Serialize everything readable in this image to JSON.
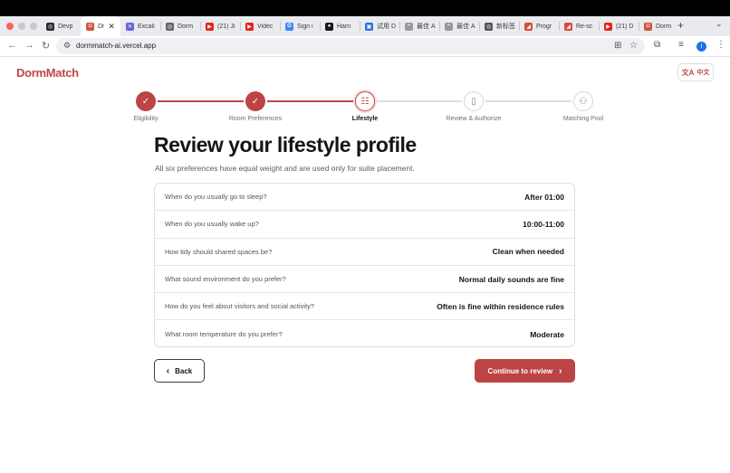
{
  "browser": {
    "tabs": [
      {
        "label": "Devp",
        "fav_color": "#2b2b2b",
        "fav_glyph": "◎"
      },
      {
        "label": "Dr",
        "fav_color": "#d0573f",
        "fav_glyph": "◘",
        "active": true,
        "close": "✕"
      },
      {
        "label": "Excali",
        "fav_color": "#6965db",
        "fav_glyph": "✕"
      },
      {
        "label": "Dorm",
        "fav_color": "#666666",
        "fav_glyph": "◎"
      },
      {
        "label": "(21) Ji",
        "fav_color": "#e62117",
        "fav_glyph": "▶"
      },
      {
        "label": "Videc",
        "fav_color": "#e62117",
        "fav_glyph": "▶"
      },
      {
        "label": "Sign i",
        "fav_color": "#4285f4",
        "fav_glyph": "G"
      },
      {
        "label": "Harri",
        "fav_color": "#181717",
        "fav_glyph": "●"
      },
      {
        "label": "试用 D",
        "fav_color": "#2f6fe4",
        "fav_glyph": "▣"
      },
      {
        "label": "最佳 A",
        "fav_color": "#999999",
        "fav_glyph": "~"
      },
      {
        "label": "最佳 A",
        "fav_color": "#999999",
        "fav_glyph": "~"
      },
      {
        "label": "新标签",
        "fav_color": "#555555",
        "fav_glyph": "◎"
      },
      {
        "label": "Progr",
        "fav_color": "#d94a3d",
        "fav_glyph": "◢"
      },
      {
        "label": "Re-sc",
        "fav_color": "#d94a3d",
        "fav_glyph": "◢"
      },
      {
        "label": "(21) D",
        "fav_color": "#e62117",
        "fav_glyph": "▶"
      },
      {
        "label": "Dorm",
        "fav_color": "#d0573f",
        "fav_glyph": "◘"
      }
    ],
    "new_tab": "+",
    "tab_menu": "⌄",
    "url": "dormmatch-ai.vercel.app",
    "profile_initial": "i"
  },
  "app": {
    "logo": "DormMatch",
    "lang_label": "中文",
    "lang_icon": "文A"
  },
  "stepper": [
    {
      "label": "Eligibility",
      "state": "done",
      "icon": "✓"
    },
    {
      "label": "Room Preferences",
      "state": "done",
      "icon": "✓"
    },
    {
      "label": "Lifestyle",
      "state": "current",
      "icon": "☷"
    },
    {
      "label": "Review & Authorize",
      "state": "todo",
      "icon": "▯"
    },
    {
      "label": "Matching Pool",
      "state": "todo",
      "icon": "⚇"
    }
  ],
  "page": {
    "title": "Review your lifestyle profile",
    "subtitle": "All six preferences have equal weight and are used only for suite placement."
  },
  "preferences": [
    {
      "question": "When do you usually go to sleep?",
      "answer": "After 01:00"
    },
    {
      "question": "When do you usually wake up?",
      "answer": "10:00-11:00"
    },
    {
      "question": "How tidy should shared spaces be?",
      "answer": "Clean when needed"
    },
    {
      "question": "What sound environment do you prefer?",
      "answer": "Normal daily sounds are fine"
    },
    {
      "question": "How do you feel about visitors and social activity?",
      "answer": "Often is fine within residence rules"
    },
    {
      "question": "What room temperature do you prefer?",
      "answer": "Moderate"
    }
  ],
  "actions": {
    "back_label": "Back",
    "continue_label": "Continue to review"
  },
  "colors": {
    "brand": "#bd4444",
    "brand_text": "#c0474a"
  }
}
